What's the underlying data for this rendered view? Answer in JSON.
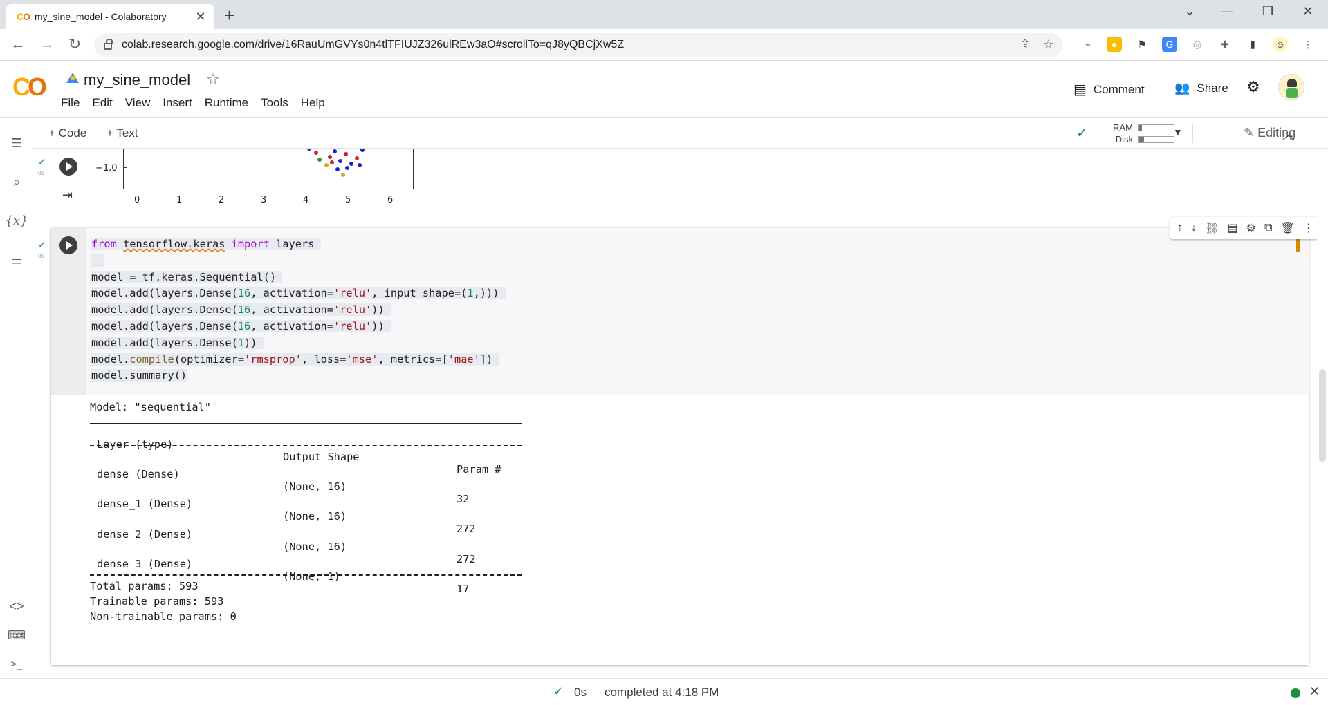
{
  "browser": {
    "tab_title": "my_sine_model - Colaboratory",
    "url": "colab.research.google.com/drive/16RauUmGVYs0n4tlTFIUJZ326ulREw3aO#scrollTo=qJ8yQBCjXw5Z"
  },
  "colab": {
    "logo": "CO",
    "notebook_title": "my_sine_model",
    "menu": [
      "File",
      "Edit",
      "View",
      "Insert",
      "Runtime",
      "Tools",
      "Help"
    ],
    "comment_label": "Comment",
    "share_label": "Share",
    "add_code_label": "Code",
    "add_text_label": "Text",
    "ram_label": "RAM",
    "disk_label": "Disk",
    "ram_usage": 0.08,
    "disk_usage": 0.14,
    "editing_label": "Editing"
  },
  "prev_output": {
    "exec_time": "0s",
    "ytick": "−1.0",
    "xticks": [
      "0",
      "1",
      "2",
      "3",
      "4",
      "5",
      "6"
    ]
  },
  "cell": {
    "exec_time": "0s",
    "code_lines": [
      "from tensorflow.keras import layers",
      "",
      "model = tf.keras.Sequential()",
      "model.add(layers.Dense(16, activation='relu', input_shape=(1,)))",
      "model.add(layers.Dense(16, activation='relu'))",
      "model.add(layers.Dense(16, activation='relu'))",
      "model.add(layers.Dense(1))",
      "model.compile(optimizer='rmsprop', loss='mse', metrics=['mae'])",
      "model.summary()"
    ]
  },
  "summary": {
    "model_line": "Model: \"sequential\"",
    "headers": [
      "Layer (type)",
      "Output Shape",
      "Param #"
    ],
    "rows": [
      [
        "dense (Dense)",
        "(None, 16)",
        "32"
      ],
      [
        "dense_1 (Dense)",
        "(None, 16)",
        "272"
      ],
      [
        "dense_2 (Dense)",
        "(None, 16)",
        "272"
      ],
      [
        "dense_3 (Dense)",
        "(None, 1)",
        "17"
      ]
    ],
    "total": "Total params: 593",
    "trainable": "Trainable params: 593",
    "non_trainable": "Non-trainable params: 0"
  },
  "status": {
    "elapsed": "0s",
    "completed": "completed at 4:18 PM"
  }
}
